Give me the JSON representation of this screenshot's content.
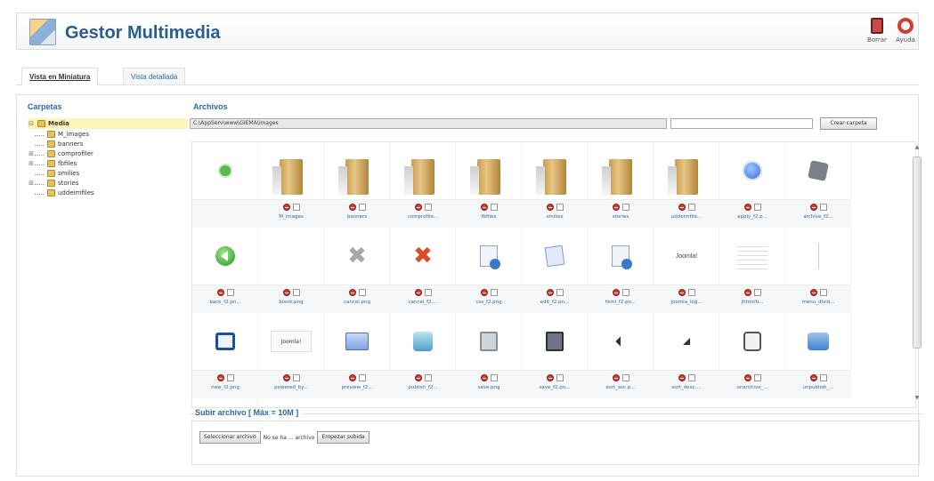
{
  "header": {
    "title": "Gestor Multimedia",
    "toolbar": [
      {
        "label": "Borrar",
        "icon": "trash-icon"
      },
      {
        "label": "Ayuda",
        "icon": "help-icon"
      }
    ]
  },
  "tabs": {
    "thumbnail_view": "Vista en Miniatura",
    "detail_view": "Vista detallada"
  },
  "folders": {
    "legend": "Carpetas",
    "root": "Media",
    "items": [
      "M_images",
      "banners",
      "comprofiler",
      "fbfiles",
      "smilies",
      "stories",
      "uddeimfiles"
    ]
  },
  "files": {
    "legend": "Archivos",
    "path": "C:\\AppServ\\www\\GIEMA\\images",
    "folder_name_value": "",
    "create_folder_button": "Crear carpeta",
    "items": [
      {
        "name": "",
        "icon": "up-icon"
      },
      {
        "name": "M_images",
        "icon": "folder-icon"
      },
      {
        "name": "banners",
        "icon": "folder-icon"
      },
      {
        "name": "comprofile...",
        "icon": "folder-icon"
      },
      {
        "name": "fbfiles",
        "icon": "folder-icon"
      },
      {
        "name": "smilies",
        "icon": "folder-icon"
      },
      {
        "name": "stories",
        "icon": "folder-icon"
      },
      {
        "name": "uddeimfile...",
        "icon": "folder-icon"
      },
      {
        "name": "apply_f2.p...",
        "icon": "apply-icon"
      },
      {
        "name": "archive_f2...",
        "icon": "archive-icon"
      },
      {
        "name": "back_f2.pn...",
        "icon": "back-icon"
      },
      {
        "name": "blank.png",
        "icon": "blank-icon"
      },
      {
        "name": "cancel.png",
        "icon": "cancel-grey-icon"
      },
      {
        "name": "cancel_f2....",
        "icon": "cancel-red-icon"
      },
      {
        "name": "css_f2.png",
        "icon": "css-icon"
      },
      {
        "name": "edit_f2.pn...",
        "icon": "edit-icon"
      },
      {
        "name": "html_f2.pn...",
        "icon": "html-icon"
      },
      {
        "name": "joomla_log...",
        "icon": "joomla-logo-icon"
      },
      {
        "name": "jhtml/ti...",
        "icon": "table-icon"
      },
      {
        "name": "menu_divid...",
        "icon": "divider-icon"
      },
      {
        "name": "new_f2.png",
        "icon": "new-icon"
      },
      {
        "name": "powered_by...",
        "icon": "powered-icon"
      },
      {
        "name": "preview_f2...",
        "icon": "preview-icon"
      },
      {
        "name": "publish_f2...",
        "icon": "publish-icon"
      },
      {
        "name": "save.png",
        "icon": "save-icon"
      },
      {
        "name": "save_f2.pn...",
        "icon": "save-dark-icon"
      },
      {
        "name": "sort_asc.p...",
        "icon": "sort-asc-icon"
      },
      {
        "name": "sort_desc....",
        "icon": "sort-desc-icon"
      },
      {
        "name": "unarchive_...",
        "icon": "unarchive-icon"
      },
      {
        "name": "unpublish_...",
        "icon": "unpublish-icon"
      },
      {
        "name": "",
        "icon": "partial-icon"
      }
    ],
    "joomla_logo_text": "Joomla!",
    "powered_text": "Joomla!"
  },
  "upload": {
    "legend": "Subir archivo [ Máx = 10M ]",
    "select_button": "Seleccionar archivo",
    "status": "No se ha ... archivo",
    "start_button": "Empezar subida"
  }
}
